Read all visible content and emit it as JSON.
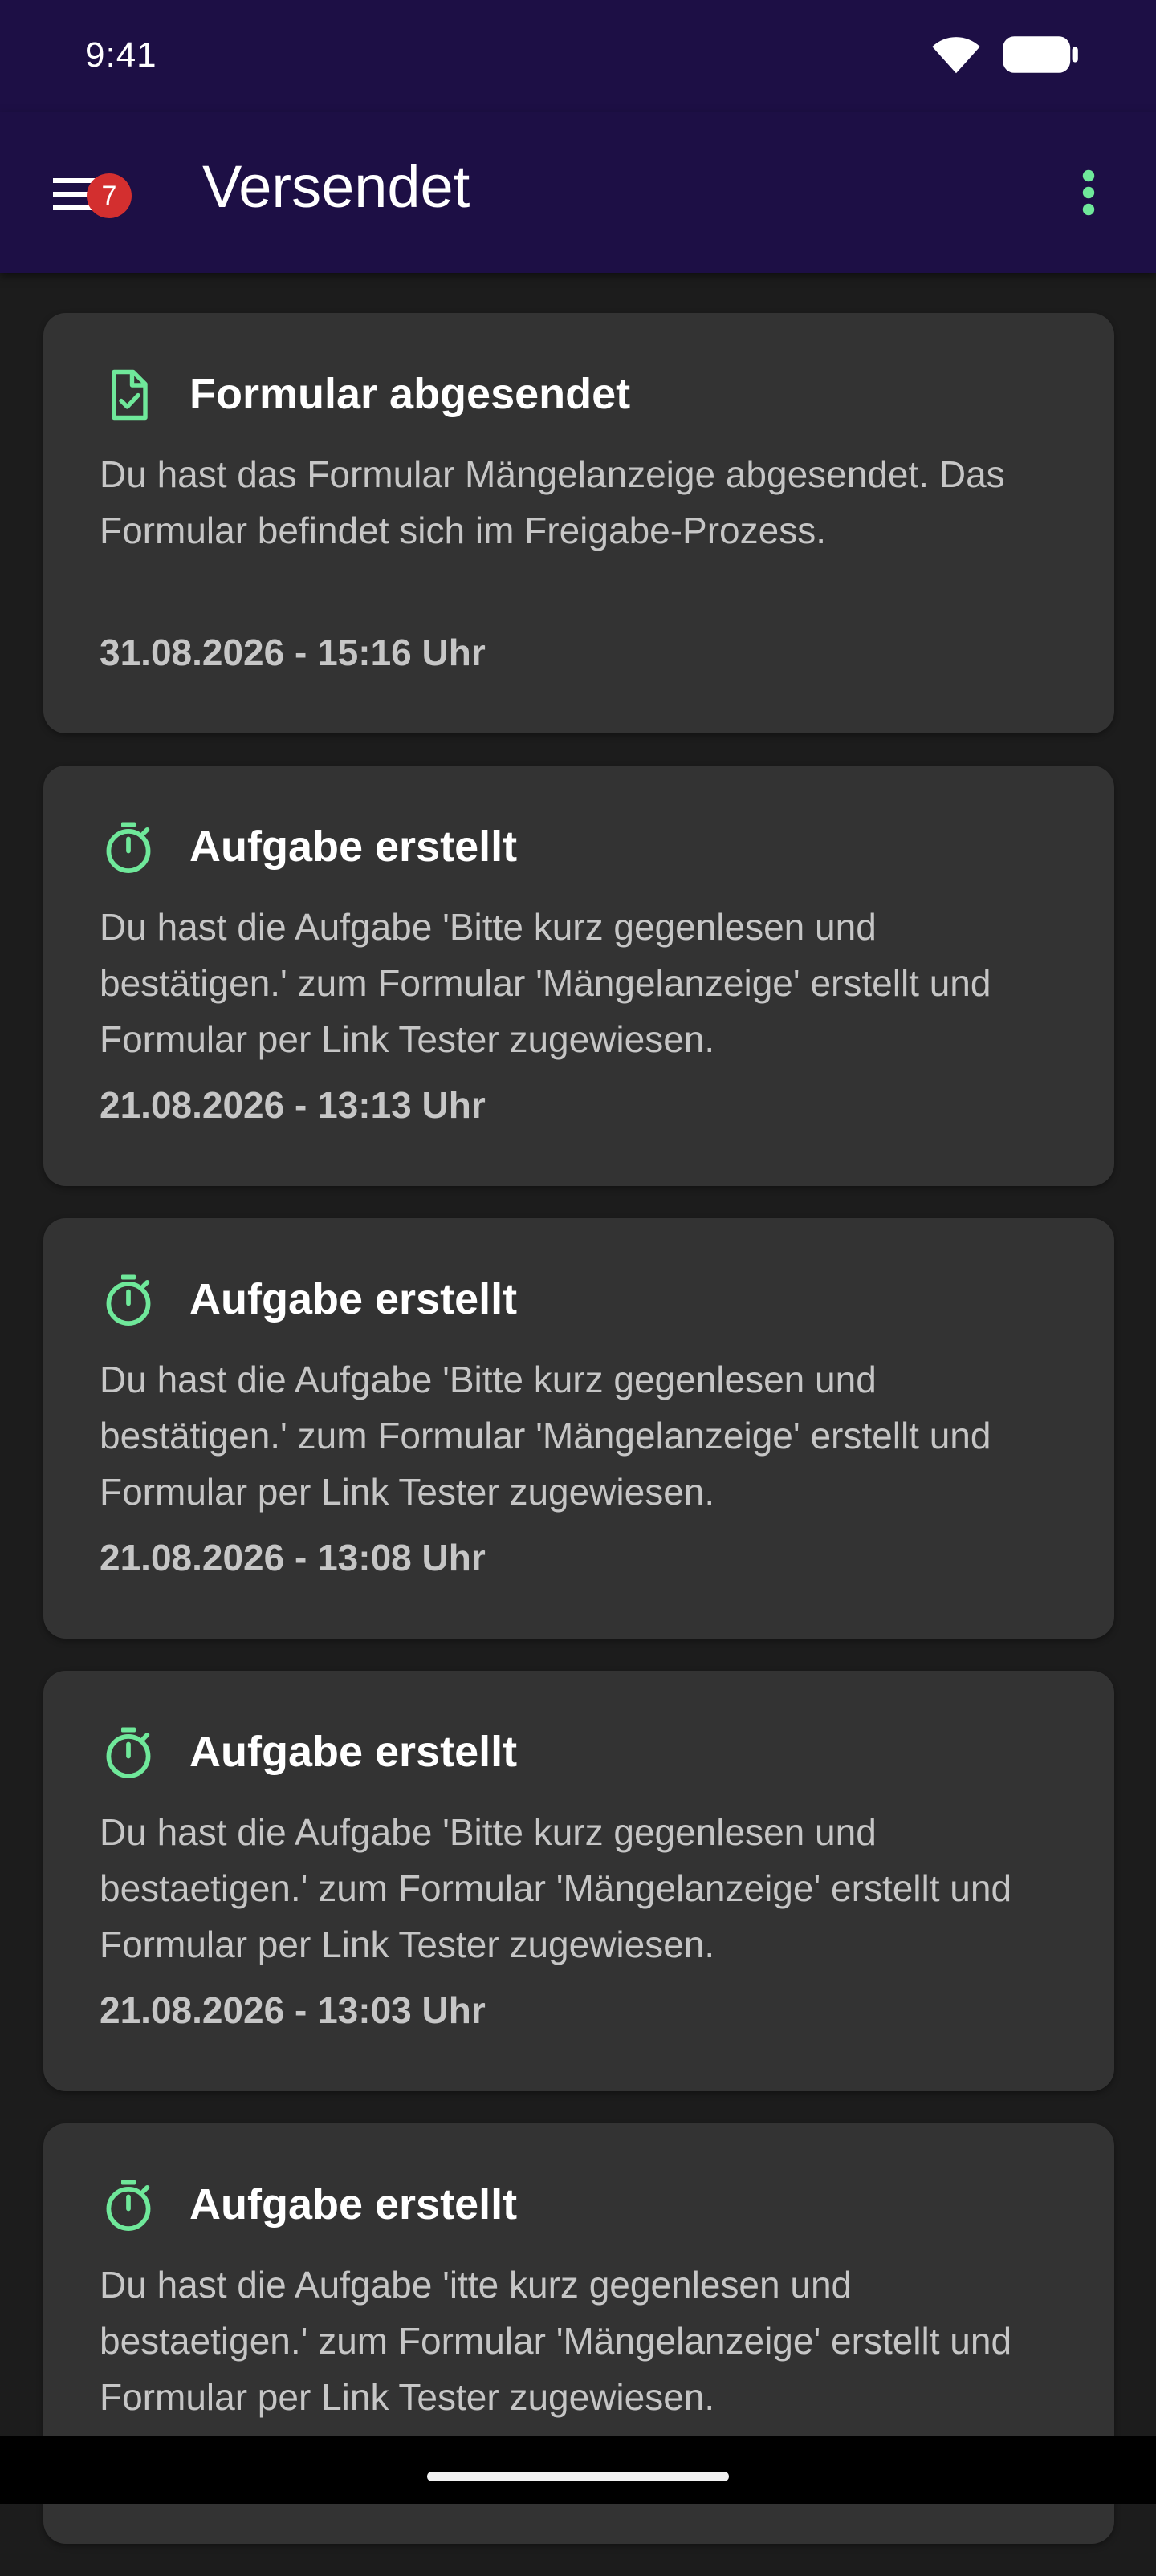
{
  "status_bar": {
    "time": "9:41"
  },
  "app_bar": {
    "title": "Versendet",
    "badge_count": "7",
    "menu_icon": "hamburger-menu-icon",
    "more_icon": "more-vert-icon"
  },
  "colors": {
    "app_bar": "#1d0f45",
    "card": "#333333",
    "accent": "#6fe89a",
    "badge": "#d32f2f",
    "text_secondary": "#c6c6c6"
  },
  "cards": [
    {
      "icon": "document-check-icon",
      "title": "Formular abgesendet",
      "text": "Du hast das Formular Mängelanzeige abgesendet. Das Formular befindet sich im Freigabe-Prozess.",
      "date": "31.08.2026 - 15:16 Uhr"
    },
    {
      "icon": "timer-icon",
      "title": "Aufgabe erstellt",
      "text": "Du hast die Aufgabe 'Bitte kurz gegenlesen und bestätigen.' zum Formular 'Mängelanzeige' erstellt und Formular per Link Tester zugewiesen.",
      "date": "21.08.2026 - 13:13 Uhr"
    },
    {
      "icon": "timer-icon",
      "title": "Aufgabe erstellt",
      "text": "Du hast die Aufgabe 'Bitte kurz gegenlesen und bestätigen.' zum Formular 'Mängelanzeige' erstellt und Formular per Link Tester zugewiesen.",
      "date": "21.08.2026 - 13:08 Uhr"
    },
    {
      "icon": "timer-icon",
      "title": "Aufgabe erstellt",
      "text": "Du hast die Aufgabe 'Bitte kurz gegenlesen und bestaetigen.' zum Formular 'Mängelanzeige' erstellt und Formular per Link Tester zugewiesen.",
      "date": "21.08.2026 - 13:03 Uhr"
    },
    {
      "icon": "timer-icon",
      "title": "Aufgabe erstellt",
      "text": "Du hast die Aufgabe 'itte kurz gegenlesen und bestaetigen.' zum Formular 'Mängelanzeige' erstellt und Formular per Link Tester zugewiesen.",
      "date": ""
    }
  ]
}
